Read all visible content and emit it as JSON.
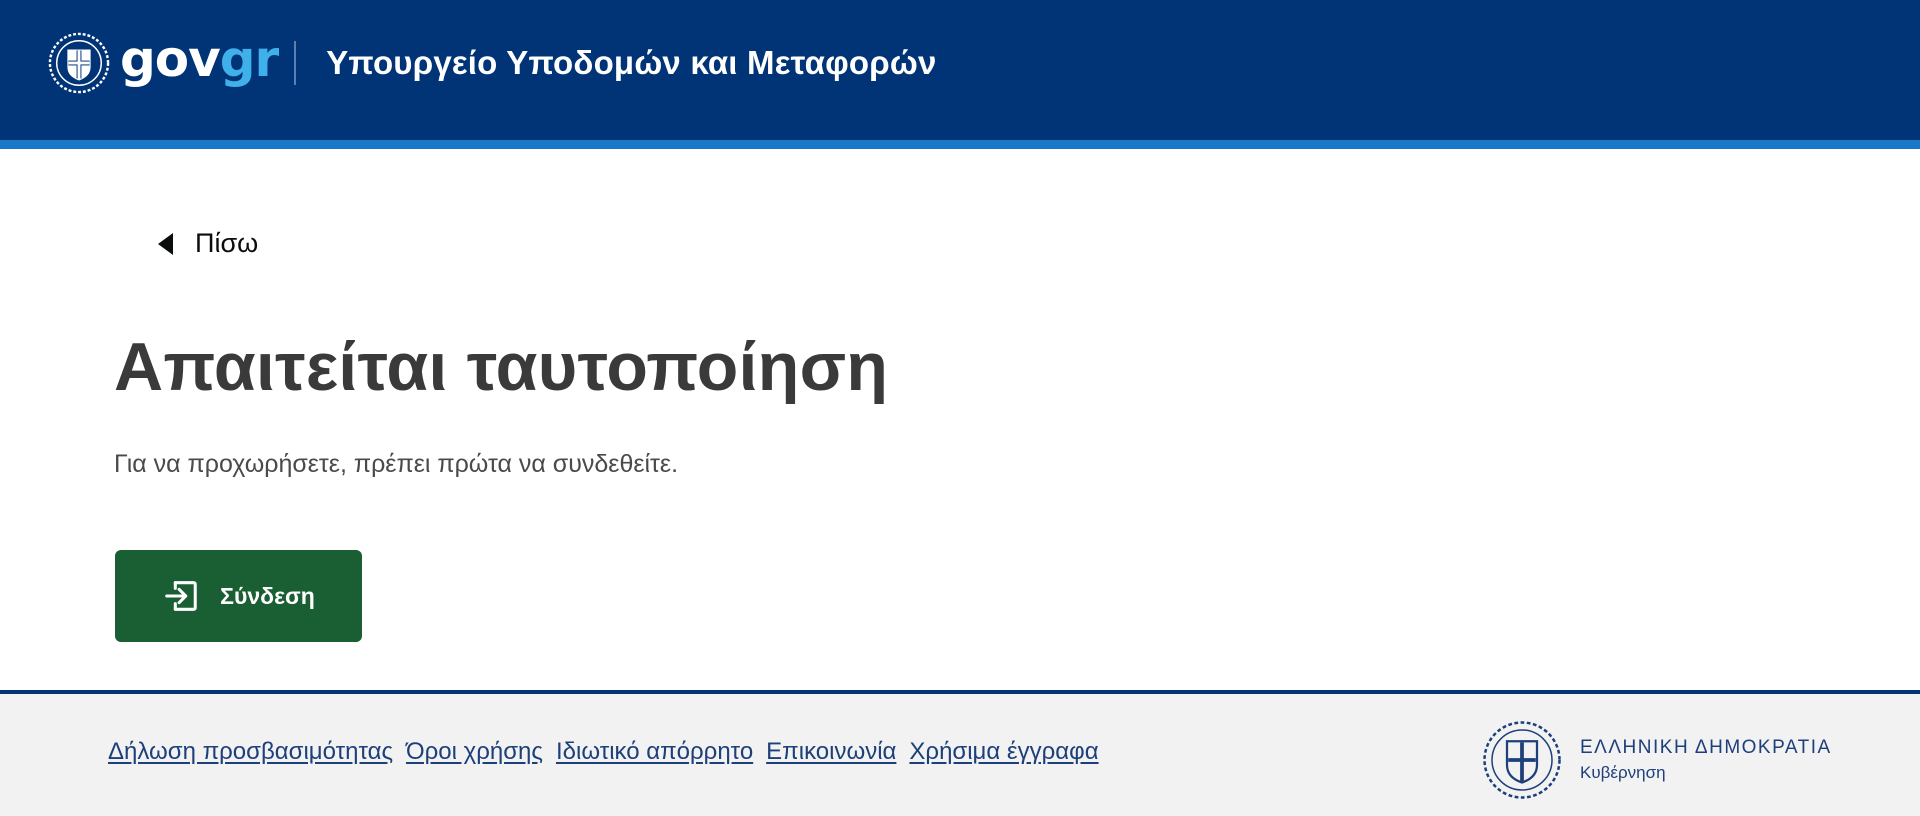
{
  "header": {
    "logo_gov": "gov",
    "logo_gr": "gr",
    "ministry_title": "Υπουργείο Υποδομών και Μεταφορών"
  },
  "main": {
    "back_label": "Πίσω",
    "title": "Απαιτείται ταυτοποίηση",
    "lead": "Για να προχωρήσετε, πρέπει πρώτα να συνδεθείτε.",
    "login_button_label": "Σύνδεση"
  },
  "footer": {
    "links": [
      {
        "label": "Δήλωση προσβασιμότητας"
      },
      {
        "label": "Όροι χρήσης"
      },
      {
        "label": "Ιδιωτικό απόρρητο"
      },
      {
        "label": "Επικοινωνία"
      },
      {
        "label": "Χρήσιμα έγγραφα"
      }
    ],
    "brand_title": "ΕΛΛΗΝΙΚΗ ΔΗΜΟΚΡΑΤΙΑ",
    "brand_subtitle": "Κυβέρνηση"
  },
  "colors": {
    "header_bg": "#003476",
    "header_stripe": "#1a78c8",
    "logo_gr": "#3fb0ea",
    "login_button_bg": "#1a5e33",
    "footer_bg": "#f2f2f2",
    "footer_link": "#1d3f7a"
  },
  "icons": {
    "header_seal": "greek-coat-of-arms-icon",
    "back": "triangle-left-icon",
    "login": "login-arrow-icon",
    "footer_seal": "greek-coat-of-arms-icon"
  }
}
